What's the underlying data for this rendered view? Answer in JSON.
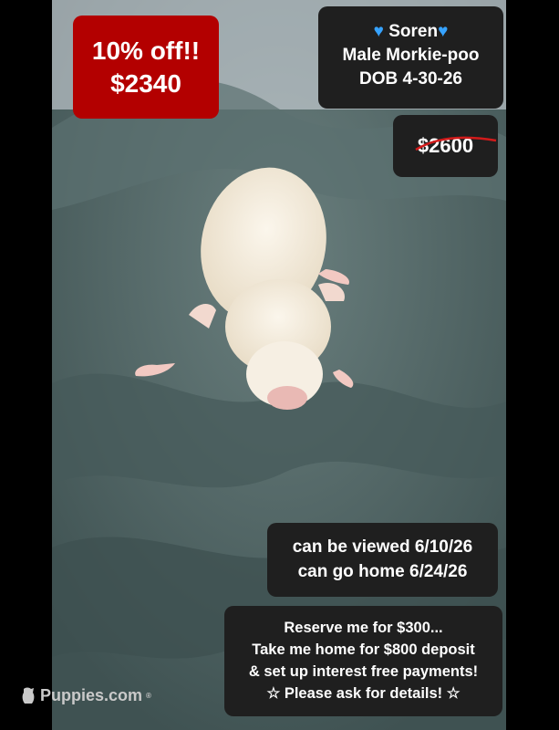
{
  "discount": {
    "line1": "10% off!!",
    "line2": "$2340",
    "color": "#b30000"
  },
  "info": {
    "heart_icon": "blue-heart",
    "name": "Soren",
    "breed": "Male Morkie-poo",
    "dob": "DOB 4-30-26"
  },
  "old_price": {
    "text": "$2600",
    "strike_color": "#d11a1a"
  },
  "viewing": {
    "line1": "can be viewed 6/10/26",
    "line2": "can go home 6/24/26"
  },
  "reserve": {
    "line1": "Reserve me for $300...",
    "line2": "Take me home for $800 deposit",
    "line3": "& set up interest free payments!",
    "line4": "Please ask for details!",
    "star_icon": "☆"
  },
  "watermark": {
    "text": "Puppies.com",
    "mark": "®",
    "icon": "dog-icon"
  },
  "colors": {
    "blanket": "#4f6464",
    "puppy": "#f4ede0",
    "heart": "#36a3ff",
    "box_bg": "#1f1f1f"
  }
}
